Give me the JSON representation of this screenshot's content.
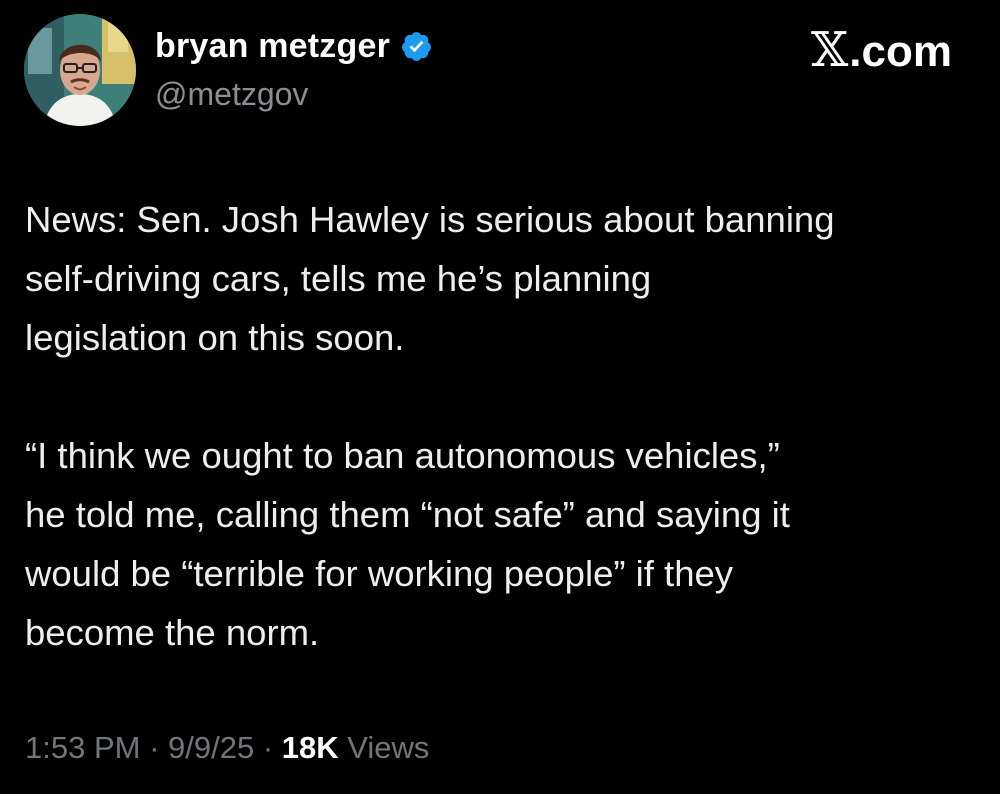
{
  "author": {
    "display_name": "bryan metzger",
    "handle": "@metzgov",
    "verified": true,
    "verified_color": "#1d9bf0"
  },
  "brand": {
    "x_glyph": "𝕏",
    "suffix": ".com"
  },
  "tweet": {
    "paragraphs": [
      "News: Sen. Josh Hawley is serious about banning\nself-driving cars, tells me he’s planning\nlegislation on this soon.",
      "“I think we ought to ban autonomous vehicles,”\nhe told me, calling them “not safe” and saying it\nwould be “terrible for working people” if they\nbecome the norm."
    ]
  },
  "meta": {
    "time": "1:53 PM",
    "separator": " · ",
    "date": "9/9/25",
    "views_count": "18K",
    "views_label": " Views"
  },
  "colors": {
    "background": "#000000",
    "text_primary": "#e7e9ea",
    "text_secondary": "#71767b"
  }
}
